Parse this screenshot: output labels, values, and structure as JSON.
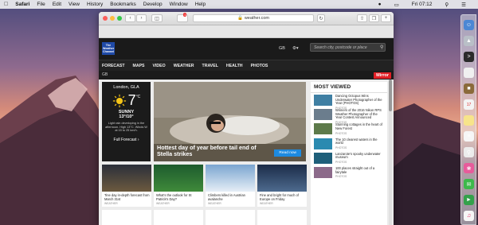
{
  "menubar": {
    "app": "Safari",
    "items": [
      "File",
      "Edit",
      "View",
      "History",
      "Bookmarks",
      "Develop",
      "Window",
      "Help"
    ],
    "clock": "Fri 07:12"
  },
  "browser": {
    "url": "weather.com",
    "tab_badge": "1"
  },
  "site": {
    "logo": "The Weather Channel",
    "unit": "GB",
    "search_placeholder": "Search city, postcode or place",
    "nav": [
      "FORECAST",
      "MAPS",
      "VIDEO",
      "WEATHER",
      "TRAVEL",
      "HEALTH",
      "PHOTOS"
    ],
    "region": "GB",
    "partner": "Mirror"
  },
  "weather": {
    "location": "London, GLA",
    "temp": "7",
    "temp_unit": "°C",
    "condition": "SUNNY",
    "hilo": "13°/10°",
    "summary": "Light rain developing in the afternoon. High 13°C. Winds W at 15 to 25 km/h.",
    "link": "Full Forecast"
  },
  "hero": {
    "caption": "Hottest day of year before tail end of Stella strikes",
    "button": "Read now"
  },
  "most_viewed": {
    "title": "MOST VIEWED",
    "items": [
      {
        "title": "Dancing Octopus Wins Underwater Photographer of the Year (PHOTOS)",
        "src": "PHOTOS"
      },
      {
        "title": "Winners of the 2016 Nikon RPS Weather Photographer of the Year Contest Announced",
        "src": "PHOTOS"
      },
      {
        "title": "Stunning cottages in the heart of New Forest",
        "src": "PHOTOS"
      },
      {
        "title": "The 10 clearest waters in the world",
        "src": "PHOTOS"
      },
      {
        "title": "Lanzarote's spooky underwater museum",
        "src": "PHOTOS"
      },
      {
        "title": "100 places straight out of a fairytale",
        "src": "PHOTOS"
      }
    ]
  },
  "cards": [
    {
      "title": "Tine day in-depth forecast from March 31st",
      "src": "WEATHER"
    },
    {
      "title": "What's the outlook for St Patrick's Day?",
      "src": "WEATHER"
    },
    {
      "title": "Climbers killed in Austrian avalanche",
      "src": "WEATHER"
    },
    {
      "title": "Fine and bright for much of Europe on Friday",
      "src": "WEATHER"
    }
  ]
}
